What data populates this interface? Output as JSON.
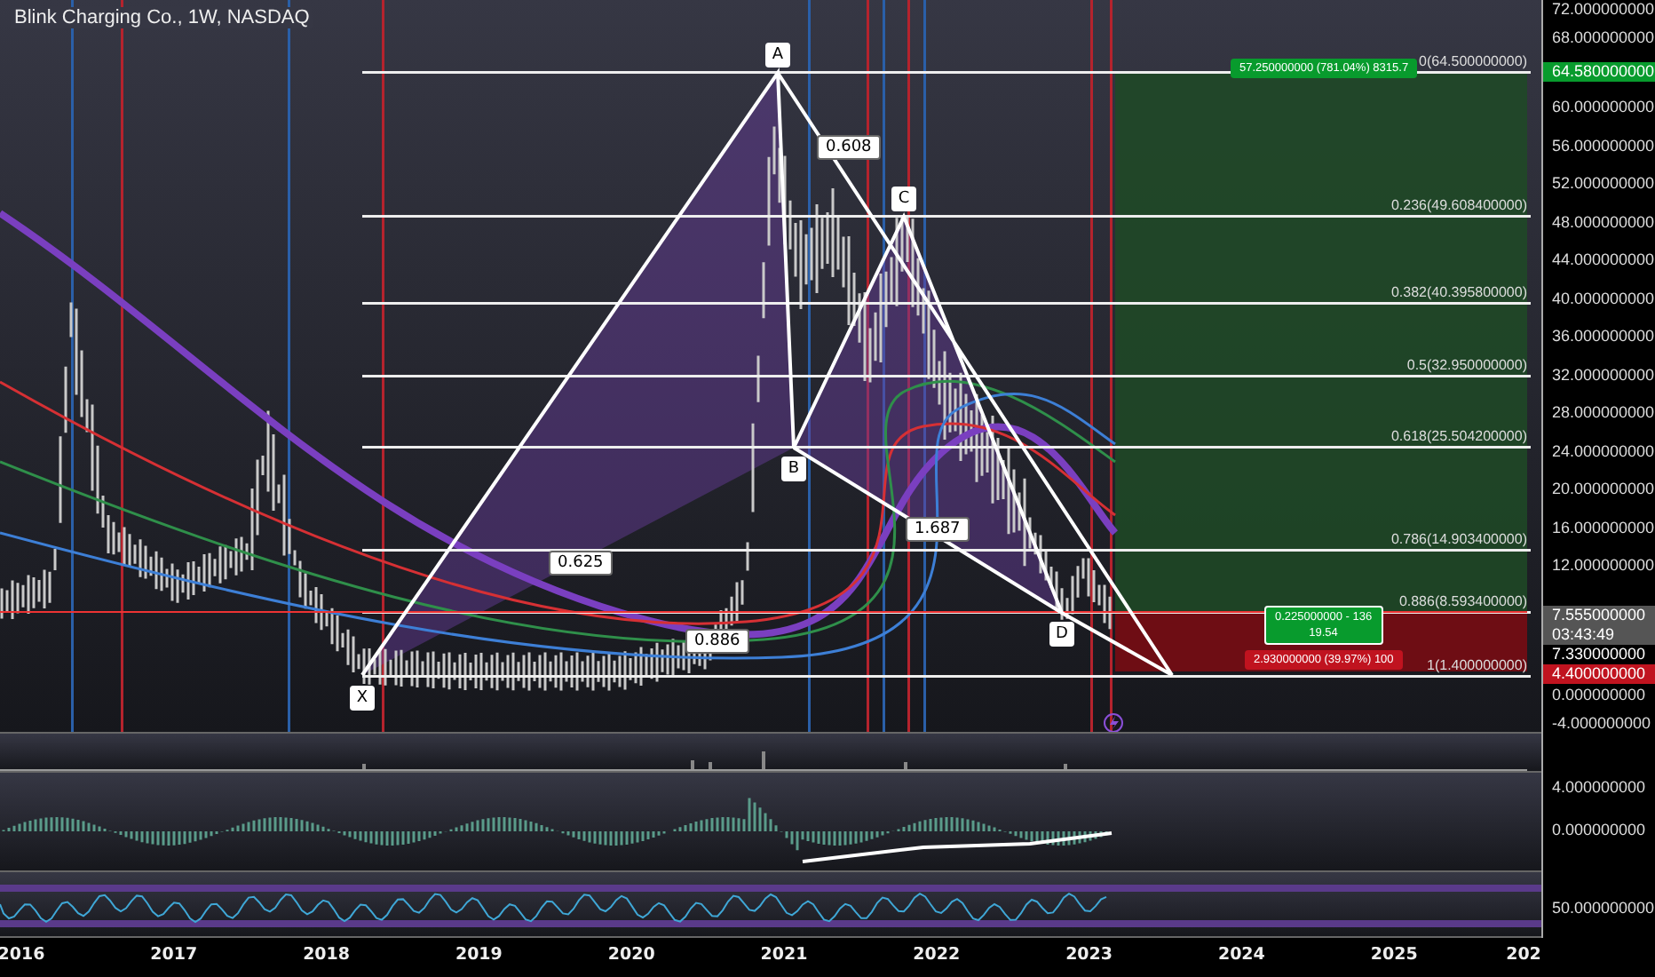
{
  "title": "Blink Charging Co., 1W, NASDAQ",
  "pattern_points": [
    "X",
    "A",
    "B",
    "C",
    "D"
  ],
  "pattern_ratios": [
    "0.608",
    "0.625",
    "1.687",
    "0.886"
  ],
  "fib_levels": [
    "0(64.500000000)",
    "0.236(49.608400000)",
    "0.382(40.395800000)",
    "0.5(32.950000000)",
    "0.618(25.504200000)",
    "0.786(14.903400000)",
    "0.886(8.593400000)",
    "1(1.400000000)"
  ],
  "position": {
    "target": "57.250000000 (781.04%) 8315.7",
    "entry_line1": "0.225000000 - 136",
    "entry_line2": "19.54",
    "stop": "2.930000000 (39.97%) 100"
  },
  "price_axis": [
    "72.000000000",
    "68.000000000",
    "60.000000000",
    "56.000000000",
    "52.000000000",
    "48.000000000",
    "44.000000000",
    "40.000000000",
    "36.000000000",
    "32.000000000",
    "28.000000000",
    "24.000000000",
    "20.000000000",
    "16.000000000",
    "12.000000000",
    "0.000000000",
    "-4.000000000"
  ],
  "price_tags": [
    {
      "kind": "target",
      "text": "64.580000000"
    },
    {
      "kind": "last",
      "text": "7.555000000",
      "countdown": "03:43:49"
    },
    {
      "kind": "plain",
      "text": "7.330000000"
    },
    {
      "kind": "stop",
      "text": "4.400000000"
    }
  ],
  "macd_axis": [
    "4.000000000",
    "0.000000000"
  ],
  "rsi_axis": [
    "50.000000000"
  ],
  "time_axis": [
    "2016",
    "2017",
    "2018",
    "2019",
    "2020",
    "2021",
    "2022",
    "2023",
    "2024",
    "2025",
    "202"
  ]
}
